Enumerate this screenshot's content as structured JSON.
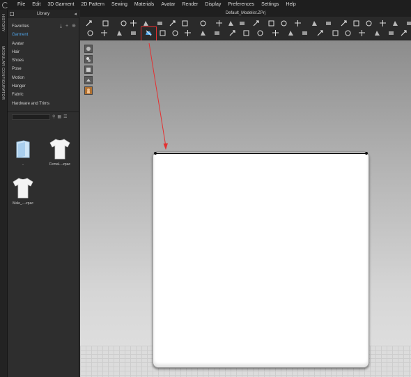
{
  "app": {
    "logo_icon": "clo-logo-icon"
  },
  "menu": [
    "File",
    "Edit",
    "3D Garment",
    "2D Pattern",
    "Sewing",
    "Materials",
    "Avatar",
    "Render",
    "Display",
    "Preferences",
    "Settings",
    "Help"
  ],
  "side_tabs": {
    "history": "HISTORY",
    "modular": "MODULAR CONFIGURATOR"
  },
  "library": {
    "title": "Library",
    "tree": [
      "Favorites",
      "Garment",
      "Avatar",
      "Hair",
      "Shoes",
      "Pose",
      "Motion",
      "Hanger",
      "Fabric",
      "Hardware and Trims"
    ],
    "active_item": "Garment",
    "thumbs": [
      {
        "label": "..",
        "kind": "folder"
      },
      {
        "label": "Femal....zpac",
        "kind": "tshirt"
      },
      {
        "label": "Male_....zpac",
        "kind": "tshirt"
      }
    ]
  },
  "document": {
    "title": "Default_Modelist.ZPrj"
  },
  "colors": {
    "accent": "#4fa3e6",
    "highlight": "#e53030",
    "garment": "#ffffff"
  }
}
